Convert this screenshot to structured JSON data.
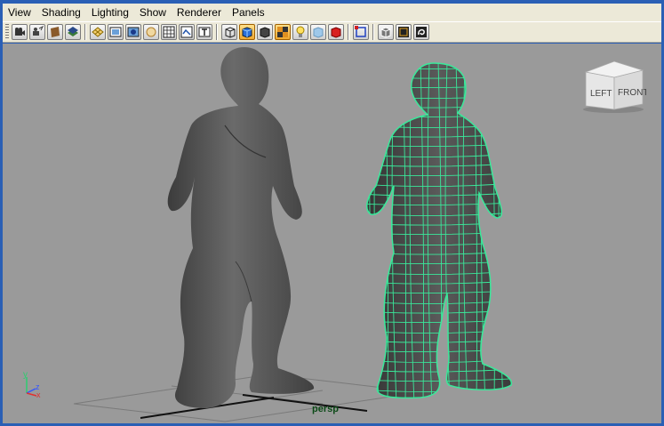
{
  "menu": {
    "items": [
      {
        "label": "View"
      },
      {
        "label": "Shading"
      },
      {
        "label": "Lighting"
      },
      {
        "label": "Show"
      },
      {
        "label": "Renderer"
      },
      {
        "label": "Panels"
      }
    ]
  },
  "toolbar": {
    "groups": [
      [
        "camera-attributes-icon",
        "camera-tools-icon",
        "image-plane-icon",
        "2d-pan-zoom-icon"
      ],
      [
        "grid-icon",
        "film-gate-icon",
        "resolution-gate-icon",
        "gate-mask-icon",
        "field-chart-icon",
        "safe-action-icon",
        "safe-title-icon"
      ],
      [
        "wireframe-icon",
        "smooth-shade-icon",
        "default-material-icon",
        "textured-icon",
        "lights-icon",
        "xray-icon",
        "render-icon"
      ],
      [
        "isolate-select-icon"
      ],
      [
        "wireframe-on-shaded-icon",
        "xray-joints-icon",
        "backface-culling-icon"
      ]
    ],
    "active": [
      "smooth-shade-icon",
      "textured-icon"
    ]
  },
  "viewport": {
    "camera_label": "persp",
    "background_color": "#9a9a9a",
    "selection_color": "#3ae89a",
    "axis": {
      "y_label": "y",
      "z_label": "z",
      "x_label": "x"
    }
  },
  "viewcube": {
    "left_label": "LEFT",
    "front_label": "FRONT"
  },
  "scene": {
    "objects": [
      {
        "name": "body-shaded",
        "shading": "smooth-shaded",
        "color": "#555555"
      },
      {
        "name": "body-wireframe",
        "shading": "wireframe-on-shaded",
        "selected": true
      }
    ]
  }
}
